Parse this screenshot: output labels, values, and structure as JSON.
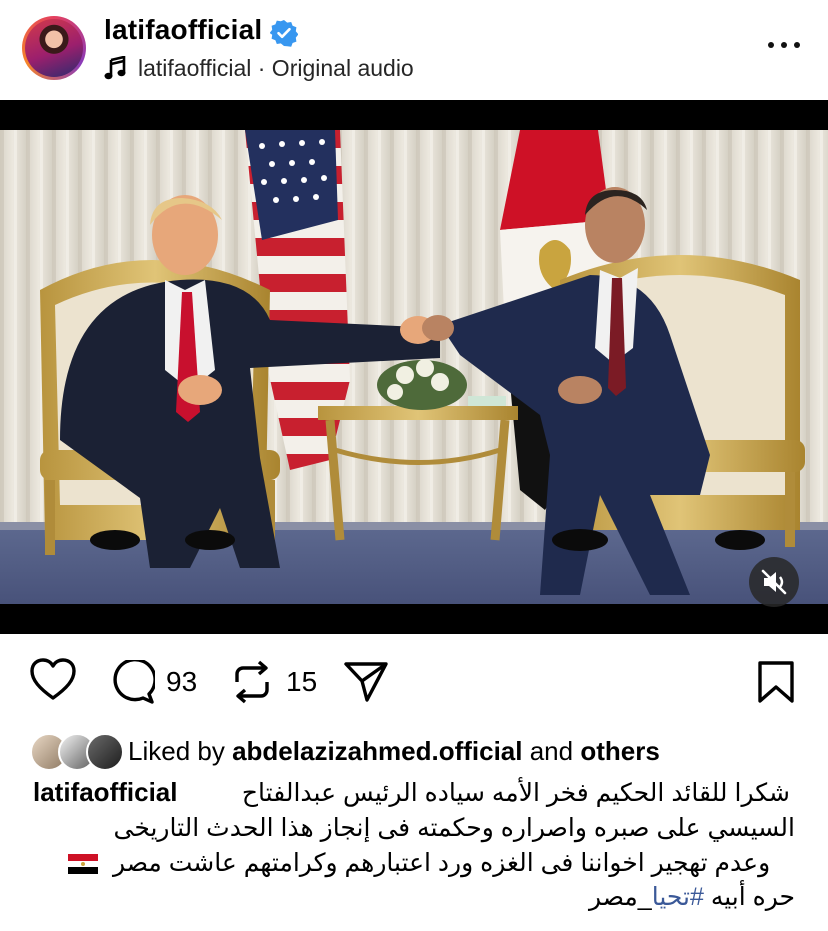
{
  "post": {
    "username": "latifaofficial",
    "verified": true,
    "audio_label": "latifaofficial · Original audio",
    "more_icon": "more-horizontal-icon"
  },
  "actions": {
    "comments_count": "93",
    "reposts_count": "15"
  },
  "likes": {
    "prefix": "Liked by",
    "user": "abdelazizahmed.official",
    "conjunction": "and",
    "others": "others"
  },
  "caption": {
    "author": "latifaofficial",
    "line1": "شكرا للقائد الحكيم فخر الأمه سياده الرئيس عبدالفتاح",
    "line2": "السيسي على صبره واصراره وحكمته فى إنجاز هذا الحدث التاريخى",
    "line3": "وعدم تهجير اخواننا فى الغزه ورد اعتبارهم وكرامتهم عاشت مصر",
    "line4_text": "حره أبيه",
    "hashtag": "#تحيا",
    "line4_tail": "_مصر"
  },
  "colors": {
    "verified_blue": "#3897f0",
    "hashtag_blue": "#3b5998",
    "egypt_red": "#ce1126",
    "egypt_black": "#000000"
  }
}
